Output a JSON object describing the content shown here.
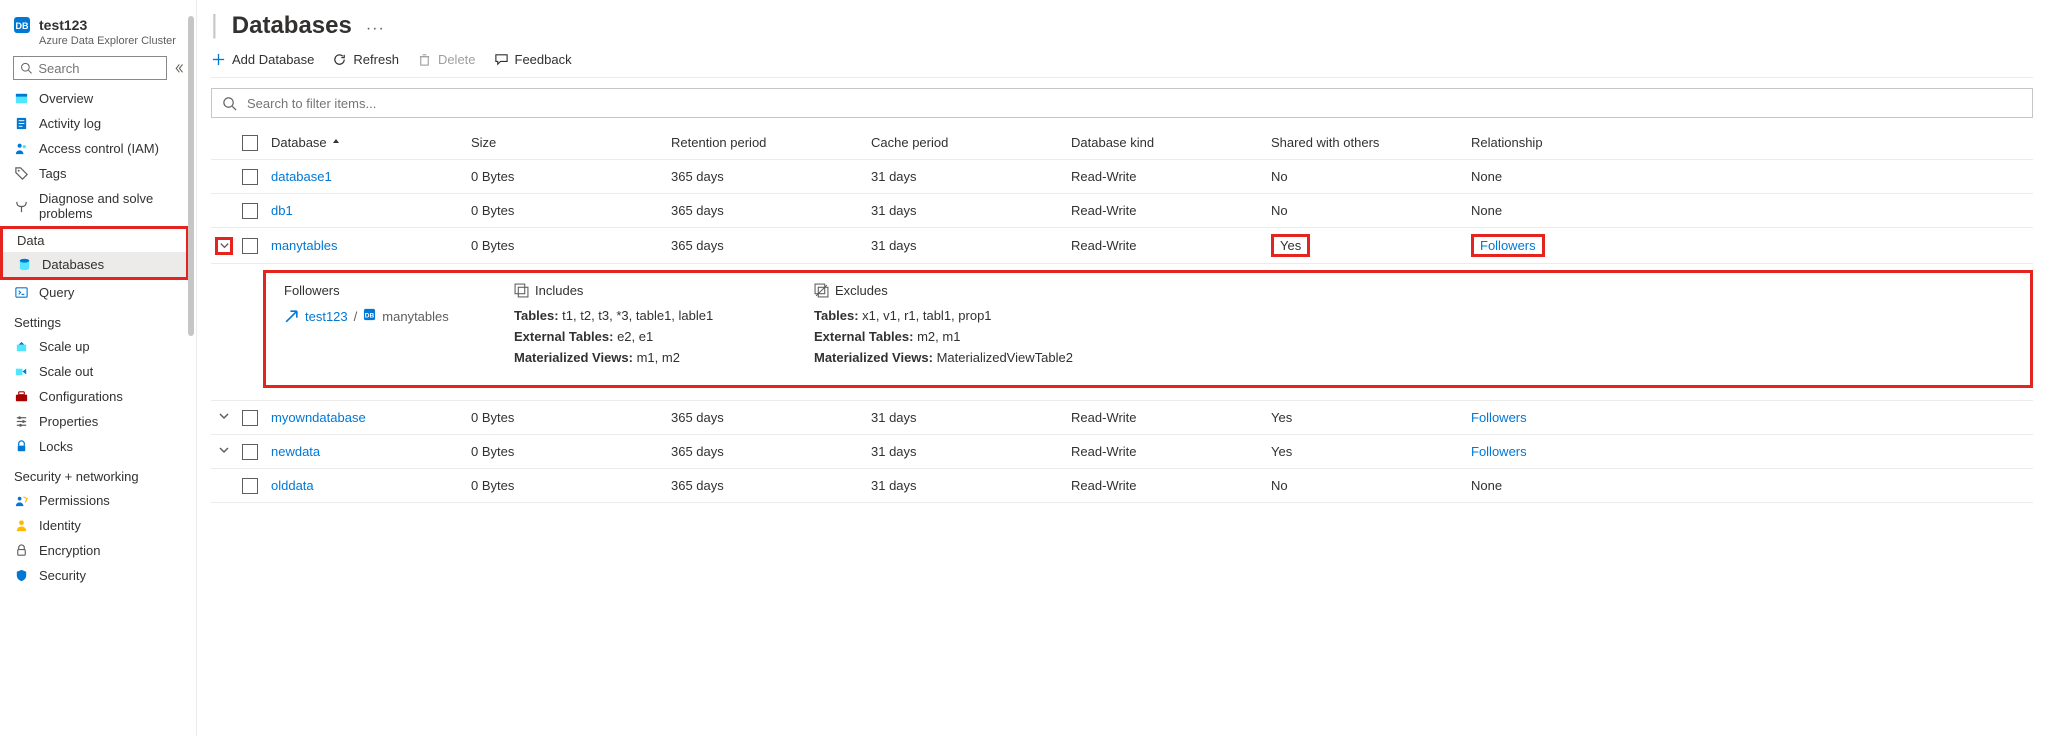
{
  "resource": {
    "name": "test123",
    "kind_label": "Azure Data Explorer Cluster"
  },
  "sidebar_search_placeholder": "Search",
  "nav": {
    "top": [
      {
        "label": "Overview"
      },
      {
        "label": "Activity log"
      },
      {
        "label": "Access control (IAM)"
      },
      {
        "label": "Tags"
      },
      {
        "label": "Diagnose and solve problems"
      }
    ],
    "data_label": "Data",
    "data_items": [
      {
        "label": "Databases"
      },
      {
        "label": "Query"
      }
    ],
    "settings_label": "Settings",
    "settings_items": [
      {
        "label": "Scale up"
      },
      {
        "label": "Scale out"
      },
      {
        "label": "Configurations"
      },
      {
        "label": "Properties"
      },
      {
        "label": "Locks"
      }
    ],
    "security_label": "Security + networking",
    "security_items": [
      {
        "label": "Permissions"
      },
      {
        "label": "Identity"
      },
      {
        "label": "Encryption"
      },
      {
        "label": "Security"
      }
    ]
  },
  "page": {
    "title": "Databases",
    "toolbar": {
      "add": "Add Database",
      "refresh": "Refresh",
      "delete": "Delete",
      "feedback": "Feedback"
    },
    "filter_placeholder": "Search to filter items..."
  },
  "columns": {
    "database": "Database",
    "size": "Size",
    "retention": "Retention period",
    "cache": "Cache period",
    "kind": "Database kind",
    "shared": "Shared with others",
    "relationship": "Relationship"
  },
  "rows": [
    {
      "name": "database1",
      "size": "0 Bytes",
      "retention": "365 days",
      "cache": "31 days",
      "kind": "Read-Write",
      "shared": "No",
      "relationship": "None",
      "rel_link": false,
      "shared_hl": false,
      "rel_hl": false,
      "expandable": false
    },
    {
      "name": "db1",
      "size": "0 Bytes",
      "retention": "365 days",
      "cache": "31 days",
      "kind": "Read-Write",
      "shared": "No",
      "relationship": "None",
      "rel_link": false,
      "shared_hl": false,
      "rel_hl": false,
      "expandable": false
    },
    {
      "name": "manytables",
      "size": "0 Bytes",
      "retention": "365 days",
      "cache": "31 days",
      "kind": "Read-Write",
      "shared": "Yes",
      "relationship": "Followers",
      "rel_link": true,
      "shared_hl": true,
      "rel_hl": true,
      "expandable": true,
      "expanded": true
    },
    {
      "name": "myowndatabase",
      "size": "0 Bytes",
      "retention": "365 days",
      "cache": "31 days",
      "kind": "Read-Write",
      "shared": "Yes",
      "relationship": "Followers",
      "rel_link": true,
      "shared_hl": false,
      "rel_hl": false,
      "expandable": true,
      "expanded": false
    },
    {
      "name": "newdata",
      "size": "0 Bytes",
      "retention": "365 days",
      "cache": "31 days",
      "kind": "Read-Write",
      "shared": "Yes",
      "relationship": "Followers",
      "rel_link": true,
      "shared_hl": false,
      "rel_hl": false,
      "expandable": true,
      "expanded": false
    },
    {
      "name": "olddata",
      "size": "0 Bytes",
      "retention": "365 days",
      "cache": "31 days",
      "kind": "Read-Write",
      "shared": "No",
      "relationship": "None",
      "rel_link": false,
      "shared_hl": false,
      "rel_hl": false,
      "expandable": false
    }
  ],
  "details": {
    "followers_header": "Followers",
    "includes_header": "Includes",
    "excludes_header": "Excludes",
    "follower_cluster": "test123",
    "follower_sep": "/",
    "follower_db": "manytables",
    "includes": {
      "tables_label": "Tables:",
      "tables": "t1, t2, t3, *3, table1, lable1",
      "ext_label": "External Tables:",
      "ext": "e2, e1",
      "mv_label": "Materialized Views:",
      "mv": "m1, m2"
    },
    "excludes": {
      "tables_label": "Tables:",
      "tables": "x1, v1, r1, tabl1, prop1",
      "ext_label": "External Tables:",
      "ext": "m2, m1",
      "mv_label": "Materialized Views:",
      "mv": "MaterializedViewTable2"
    }
  }
}
